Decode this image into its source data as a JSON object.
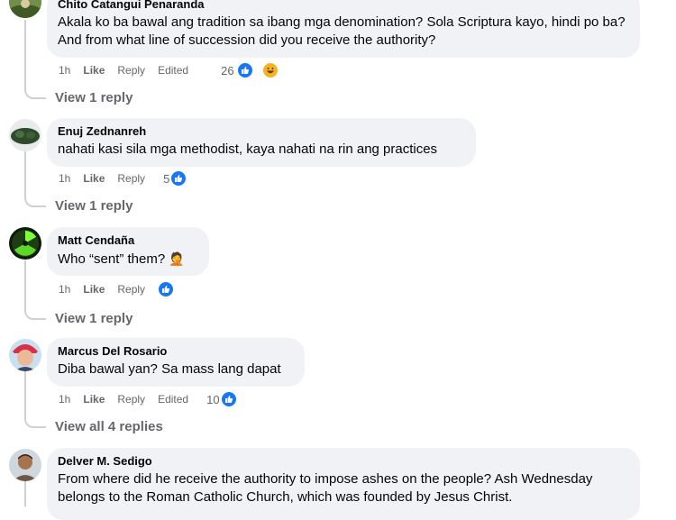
{
  "comments": [
    {
      "author": "Chito Catangui Penaranda",
      "text": "Akala ko ba bawal ang tradition sa ibang mga denomination? Sola Scriptura kayo, hindi po ba? And from what line of succession did you receive the authority?",
      "time": "1h",
      "like": "Like",
      "reply": "Reply",
      "edited": "Edited",
      "reaction_count": "26",
      "reactions": [
        "like-icon",
        "haha-icon"
      ],
      "view_replies": "View 1 reply"
    },
    {
      "author": "Enuj Zednanreh",
      "text": "nahati kasi sila mga methodist, kaya nahati na rin ang practices",
      "time": "1h",
      "like": "Like",
      "reply": "Reply",
      "reaction_count": "5",
      "reactions": [
        "like-icon"
      ],
      "view_replies": "View 1 reply"
    },
    {
      "author": "Matt Cendaña",
      "text": "Who “sent” them?",
      "emoji": "🤦",
      "time": "1h",
      "like": "Like",
      "reply": "Reply",
      "reaction_count": "",
      "reactions": [
        "like-icon"
      ],
      "view_replies": "View 1 reply"
    },
    {
      "author": "Marcus Del Rosario",
      "text": "Diba bawal yan? Sa mass lang dapat",
      "time": "1h",
      "like": "Like",
      "reply": "Reply",
      "edited": "Edited",
      "reaction_count": "10",
      "reactions": [
        "like-icon"
      ],
      "view_replies": "View all 4 replies"
    },
    {
      "author": "Delver M. Sedigo",
      "text": "From where did he receive the authority to impose ashes on the people? Ash Wednesday belongs to the Roman Catholic Church, which was founded by Jesus Christ."
    }
  ],
  "colors": {
    "bubble": "#f0f2f5",
    "secondary_text": "#65676b",
    "like_blue": "#1877f2",
    "haha_yellow": "#f7b125"
  }
}
